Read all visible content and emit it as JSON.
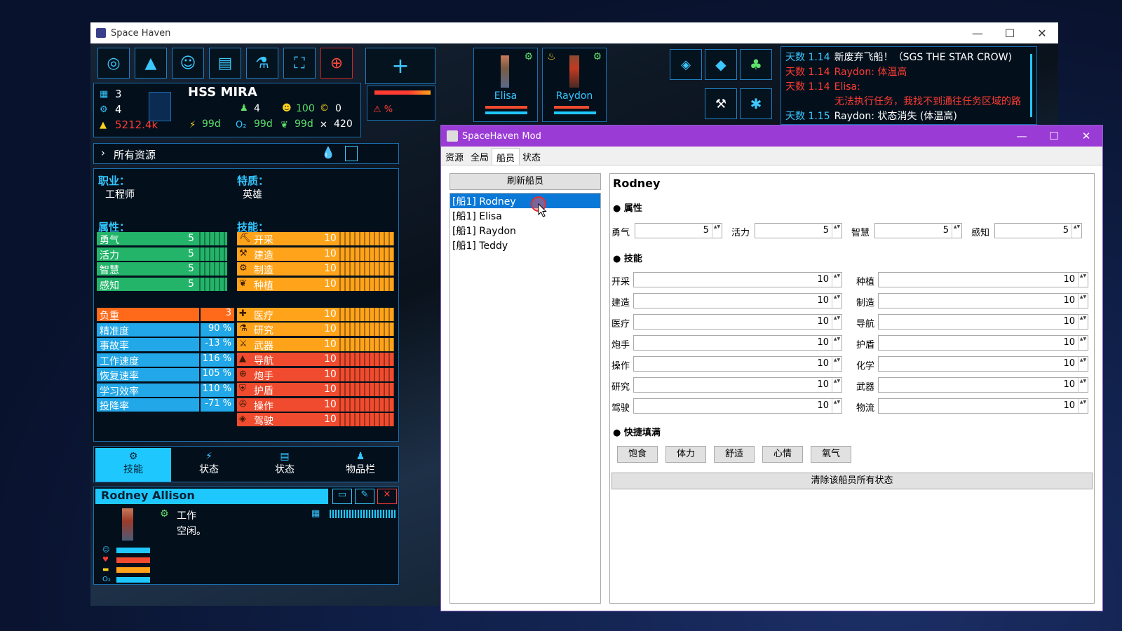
{
  "game": {
    "window_title": "Space Haven",
    "ship_name": "HSS MIRA",
    "stats": {
      "s1": "3",
      "s2": "4",
      "credits": "5212.4k",
      "c1": "4",
      "c2": "100",
      "c3": "0",
      "energy": "99d",
      "oxygen": "99d",
      "food": "99d",
      "tools": "420"
    },
    "resources_label": "所有资源",
    "crew_portraits": [
      "Elisa",
      "Raydon"
    ],
    "log": [
      {
        "day": "天数 1.14",
        "text": "新废弃飞船！（SGS THE STAR CROW)",
        "color": "#ffffff",
        "daycolor": "#3cc8ff"
      },
      {
        "day": "天数 1.14",
        "text": "Raydon: 体温高",
        "color": "#ff3b32",
        "daycolor": "#ff3b32"
      },
      {
        "day": "天数 1.14",
        "text": "Elisa:",
        "color": "#ff3b32",
        "daycolor": "#ff3b32"
      },
      {
        "day": "",
        "text": "无法执行任务，我找不到通往任务区域的路",
        "color": "#ff3b32",
        "daycolor": "#ff3b32"
      },
      {
        "day": "天数 1.15",
        "text": "Raydon: 状态消失 (体温高)",
        "color": "#ffffff",
        "daycolor": "#3cc8ff"
      }
    ],
    "job_label": "职业：",
    "job_value": "工程师",
    "trait_label": "特质：",
    "trait_value": "英雄",
    "attr_label": "属性：",
    "skill_label": "技能：",
    "attributes": [
      {
        "name": "勇气",
        "value": "5"
      },
      {
        "name": "活力",
        "value": "5"
      },
      {
        "name": "智慧",
        "value": "5"
      },
      {
        "name": "感知",
        "value": "5"
      }
    ],
    "derived": [
      {
        "name": "负重",
        "value": "3",
        "color": "#ff6a1a"
      },
      {
        "name": "精准度",
        "value": "90 %",
        "color": "#22a7e8"
      },
      {
        "name": "事故率",
        "value": "-13 %",
        "color": "#22a7e8"
      },
      {
        "name": "工作速度",
        "value": "116 %",
        "color": "#22a7e8"
      },
      {
        "name": "恢复速率",
        "value": "105 %",
        "color": "#22a7e8"
      },
      {
        "name": "学习效率",
        "value": "110 %",
        "color": "#22a7e8"
      },
      {
        "name": "投降率",
        "value": "-71 %",
        "color": "#22a7e8"
      }
    ],
    "skills": [
      {
        "name": "开采",
        "value": "10",
        "color": "#ffa31a"
      },
      {
        "name": "建造",
        "value": "10",
        "color": "#ffa31a"
      },
      {
        "name": "制造",
        "value": "10",
        "color": "#ffa31a"
      },
      {
        "name": "种植",
        "value": "10",
        "color": "#ffa31a"
      },
      {
        "name": "医疗",
        "value": "10",
        "color": "#ffa31a"
      },
      {
        "name": "研究",
        "value": "10",
        "color": "#ffa31a"
      },
      {
        "name": "武器",
        "value": "10",
        "color": "#ffa31a"
      },
      {
        "name": "导航",
        "value": "10",
        "color": "#f04b2e"
      },
      {
        "name": "炮手",
        "value": "10",
        "color": "#f04b2e"
      },
      {
        "name": "护盾",
        "value": "10",
        "color": "#f04b2e"
      },
      {
        "name": "操作",
        "value": "10",
        "color": "#f04b2e"
      },
      {
        "name": "驾驶",
        "value": "10",
        "color": "#f04b2e"
      }
    ],
    "tabs": [
      "技能",
      "状态",
      "状态",
      "物品栏"
    ],
    "crew_name": "Rodney Allison",
    "task": "工作",
    "task_state": "空闲。"
  },
  "mod": {
    "title": "SpaceHaven Mod",
    "tabs": [
      "资源",
      "全局",
      "船员",
      "状态"
    ],
    "refresh": "刷新船员",
    "crew_list": [
      "[船1] Rodney",
      "[船1] Elisa",
      "[船1] Raydon",
      "[船1] Teddy"
    ],
    "selected": "Rodney",
    "attr_header": "● 属性",
    "skill_header": "● 技能",
    "quick_header": "● 快捷填满",
    "attrs": [
      {
        "label": "勇气",
        "value": "5"
      },
      {
        "label": "活力",
        "value": "5"
      },
      {
        "label": "智慧",
        "value": "5"
      },
      {
        "label": "感知",
        "value": "5"
      }
    ],
    "skills_left": [
      {
        "label": "开采",
        "value": "10"
      },
      {
        "label": "建造",
        "value": "10"
      },
      {
        "label": "医疗",
        "value": "10"
      },
      {
        "label": "炮手",
        "value": "10"
      },
      {
        "label": "操作",
        "value": "10"
      },
      {
        "label": "研究",
        "value": "10"
      },
      {
        "label": "驾驶",
        "value": "10"
      }
    ],
    "skills_right": [
      {
        "label": "种植",
        "value": "10"
      },
      {
        "label": "制造",
        "value": "10"
      },
      {
        "label": "导航",
        "value": "10"
      },
      {
        "label": "护盾",
        "value": "10"
      },
      {
        "label": "化学",
        "value": "10"
      },
      {
        "label": "武器",
        "value": "10"
      },
      {
        "label": "物流",
        "value": "10"
      }
    ],
    "quick": [
      "饱食",
      "体力",
      "舒适",
      "心情",
      "氧气"
    ],
    "clear": "清除该船员所有状态"
  }
}
